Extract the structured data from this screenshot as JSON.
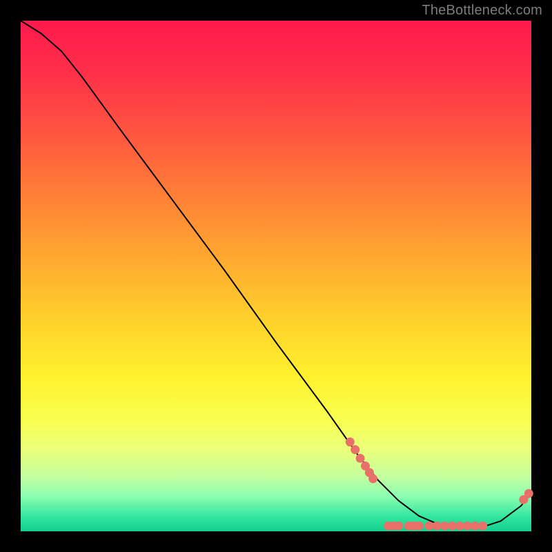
{
  "watermark": "TheBottleneck.com",
  "chart_data": {
    "type": "line",
    "title": "",
    "xlabel": "",
    "ylabel": "",
    "xlim": [
      0,
      100
    ],
    "ylim": [
      0,
      100
    ],
    "grid": false,
    "legend": false,
    "series": [
      {
        "name": "curve",
        "x": [
          0,
          4,
          8,
          12,
          20,
          30,
          40,
          50,
          60,
          66,
          70,
          74,
          78,
          82,
          86,
          90,
          94,
          98,
          100
        ],
        "y": [
          100,
          97.5,
          94,
          89,
          78,
          64.5,
          51,
          37,
          23.5,
          15,
          10,
          6,
          3,
          1.3,
          0.7,
          0.7,
          2,
          5,
          7.5
        ]
      }
    ],
    "markers": [
      {
        "name": "dots",
        "color": "#e77169",
        "radius": 6.5,
        "points_xy": [
          [
            64.5,
            17.5
          ],
          [
            65.5,
            16.0
          ],
          [
            66.5,
            14.3
          ],
          [
            67.5,
            12.8
          ],
          [
            68.3,
            11.5
          ],
          [
            69.0,
            10.3
          ],
          [
            72.0,
            1.05
          ],
          [
            73.0,
            1.05
          ],
          [
            74.0,
            1.05
          ],
          [
            76.0,
            1.05
          ],
          [
            77.0,
            1.05
          ],
          [
            78.0,
            1.05
          ],
          [
            80.0,
            1.05
          ],
          [
            81.5,
            1.05
          ],
          [
            83.0,
            1.05
          ],
          [
            84.5,
            1.05
          ],
          [
            86.0,
            1.05
          ],
          [
            87.5,
            1.05
          ],
          [
            89.0,
            1.05
          ],
          [
            90.5,
            1.05
          ],
          [
            98.5,
            6.2
          ],
          [
            99.5,
            7.4
          ]
        ]
      }
    ]
  }
}
